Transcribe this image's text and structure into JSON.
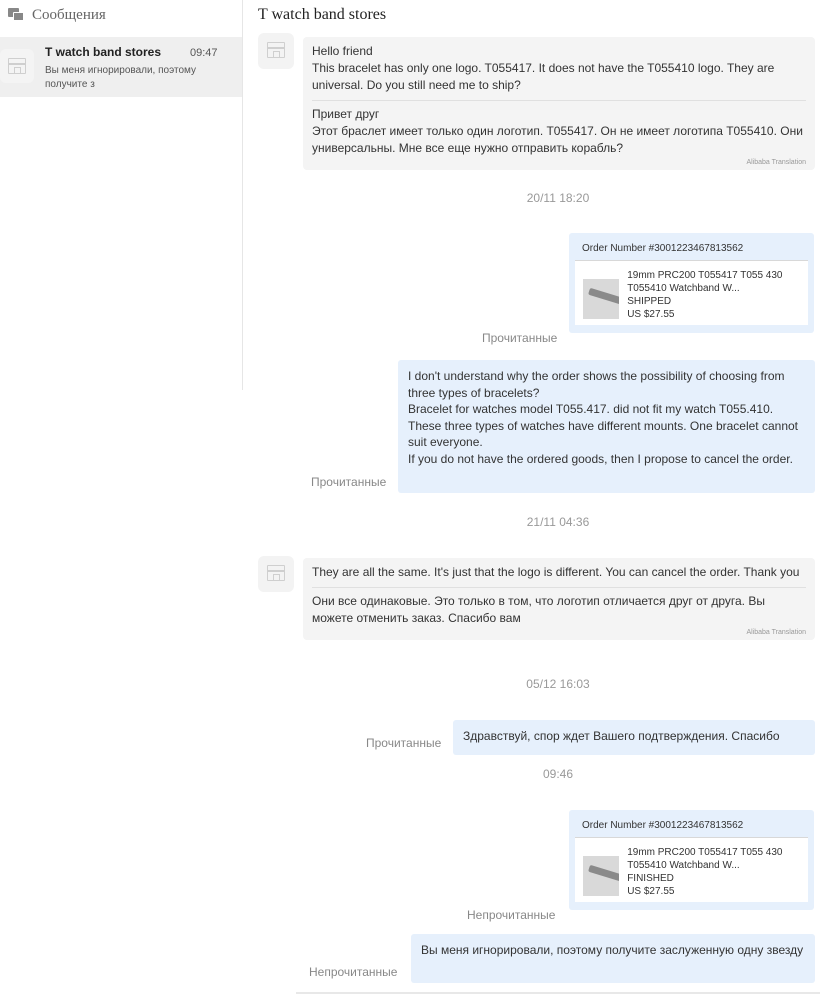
{
  "sidebar": {
    "header_title": "Сообщения",
    "conversation": {
      "name": "T watch band stores",
      "time": "09:47",
      "preview": "Вы меня игнорировали, поэтому получите з"
    }
  },
  "chat": {
    "title": "T watch band stores",
    "messages": {
      "m1": {
        "original": "Hello friend\nThis bracelet has only one logo. T055417. It does not have the T055410 logo. They are universal. Do you still need me to ship?",
        "translation": "Привет друг\nЭтот браслет имеет только один логотип. T055417. Он не имеет логотипа T055410. Они универсальны. Мне все еще нужно отправить корабль?",
        "translation_note": "Alibaba Translation"
      },
      "ts1": "20/11 18:20",
      "order1": {
        "order_number": "Order Number #3001223467813562",
        "title": "19mm PRC200 T055417 T055 430 T055410 Watchband W...",
        "status": "SHIPPED",
        "price": "US $27.55",
        "read": "Прочитанные"
      },
      "m2": {
        "text": "I don't understand why the order shows the possibility of choosing from three types of bracelets?\nBracelet for watches model T055.417. did not fit my watch T055.410.\nThese three types of watches have different mounts. One bracelet cannot suit everyone.\nIf you do not have the ordered goods, then I propose to cancel the order.",
        "read": "Прочитанные"
      },
      "ts2": "21/11 04:36",
      "m3": {
        "original": "They are all the same. It's just that the logo is different. You can cancel the order. Thank you",
        "translation": "Они все одинаковые. Это только в том, что логотип отличается друг от друга. Вы можете отменить заказ. Спасибо вам",
        "translation_note": "Alibaba Translation"
      },
      "ts3": "05/12 16:03",
      "m4": {
        "text": "Здравствуй, спор ждет Вашего подтверждения. Спасибо",
        "read": "Прочитанные"
      },
      "ts4": "09:46",
      "order2": {
        "order_number": "Order Number #3001223467813562",
        "title": "19mm PRC200 T055417 T055 430 T055410 Watchband W...",
        "status": "FINISHED",
        "price": "US $27.55",
        "read": "Непрочитанные"
      },
      "m5": {
        "text": "Вы меня игнорировали, поэтому получите заслуженную одну звезду",
        "read": "Непрочитанные"
      }
    }
  },
  "colors": {
    "outgoing_bubble": "#e6f0fc",
    "incoming_bubble": "#f4f4f4",
    "muted_text": "#888888"
  }
}
